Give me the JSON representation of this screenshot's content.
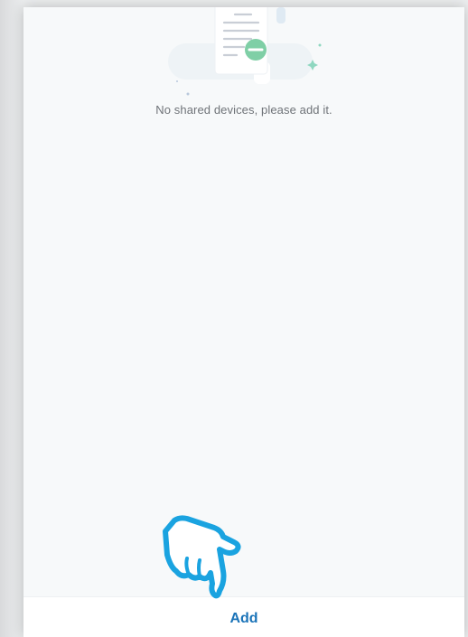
{
  "empty_state": {
    "message": "No shared devices, please add it.",
    "illustration_icon": "document-minus-icon"
  },
  "bottom_bar": {
    "add_label": "Add"
  },
  "overlay": {
    "pointer_icon": "hand-pointer-icon"
  },
  "colors": {
    "accent": "#1a73b8",
    "pointer_stroke": "#1aa3e0",
    "badge_green": "#7fcfa6"
  }
}
